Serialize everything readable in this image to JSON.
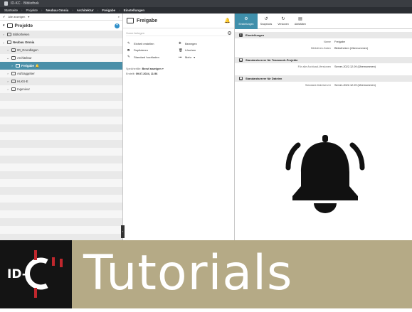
{
  "app": {
    "title": "ID-KC · Bibliothek"
  },
  "breadcrumbs": [
    "Startseite",
    "Projekte",
    "Neubau Omnia",
    "Architektur",
    "Freigabe",
    "Einstellungen"
  ],
  "left": {
    "toolbar": {
      "filter_label": "Alle anzeigen",
      "extra": "•"
    },
    "header": "Projekte",
    "rows": [
      {
        "label": "Bibliotheken"
      },
      {
        "label": "Neubau Omnia"
      },
      {
        "label": "00_Grundlagen"
      },
      {
        "label": "Architektur"
      },
      {
        "label": "Freigabe"
      },
      {
        "label": "Auftraggeber"
      },
      {
        "label": "HLKS-E"
      },
      {
        "label": "Ingenieur"
      }
    ]
  },
  "middle": {
    "title": "Freigabe",
    "search_placeholder": "Vorne Anlegen",
    "actions": [
      {
        "icon": "✎",
        "label": "Einheit erstellen"
      },
      {
        "icon": "✥",
        "label": "Bewegen"
      },
      {
        "icon": "⧉",
        "label": "Duplizieren"
      },
      {
        "icon": "🗑",
        "label": "Löschen"
      },
      {
        "icon": "✎",
        "label": "Standard hochladen"
      },
      {
        "icon": "•••",
        "label": "Mehr"
      }
    ],
    "meta_label": "Speicherlilie",
    "meta_value": "Beruf anzeigen",
    "created_label": "Erstellt:",
    "created_value": "09.07.2024, 11:56"
  },
  "right": {
    "tabs": [
      {
        "icon": "⚙",
        "label": "Einstellungen"
      },
      {
        "icon": "↺",
        "label": "Snapshots"
      },
      {
        "icon": "↻",
        "label": "Versionen"
      },
      {
        "icon": "▤",
        "label": "Aktivitäten"
      }
    ],
    "sections": [
      {
        "title": "Einstellungen",
        "icon": "i",
        "rows": [
          {
            "k": "Name",
            "v": "Freigabe"
          },
          {
            "k": "Bibliothek-Daten",
            "v": "Bibliotheken (Übernommen)"
          }
        ]
      },
      {
        "title": "Standardserver für Teamwork-Projekte",
        "icon": "▦",
        "rows": [
          {
            "k": "Für alle Archicad-Versionen",
            "v": "Server-2022.12.09 (Übernommen)"
          }
        ]
      },
      {
        "title": "Standardserver für Dateien",
        "icon": "▦",
        "rows": [
          {
            "k": "Standard-Dateiserver",
            "v": "Server-2022.12.09 (Übernommen)"
          }
        ]
      }
    ]
  },
  "banner": {
    "tutorials": "Tutorials",
    "logo_text": "ID-C"
  },
  "colors": {
    "accent": "#3f8fab",
    "banner": "#b5aa86",
    "topbar": "#2b2e33"
  }
}
